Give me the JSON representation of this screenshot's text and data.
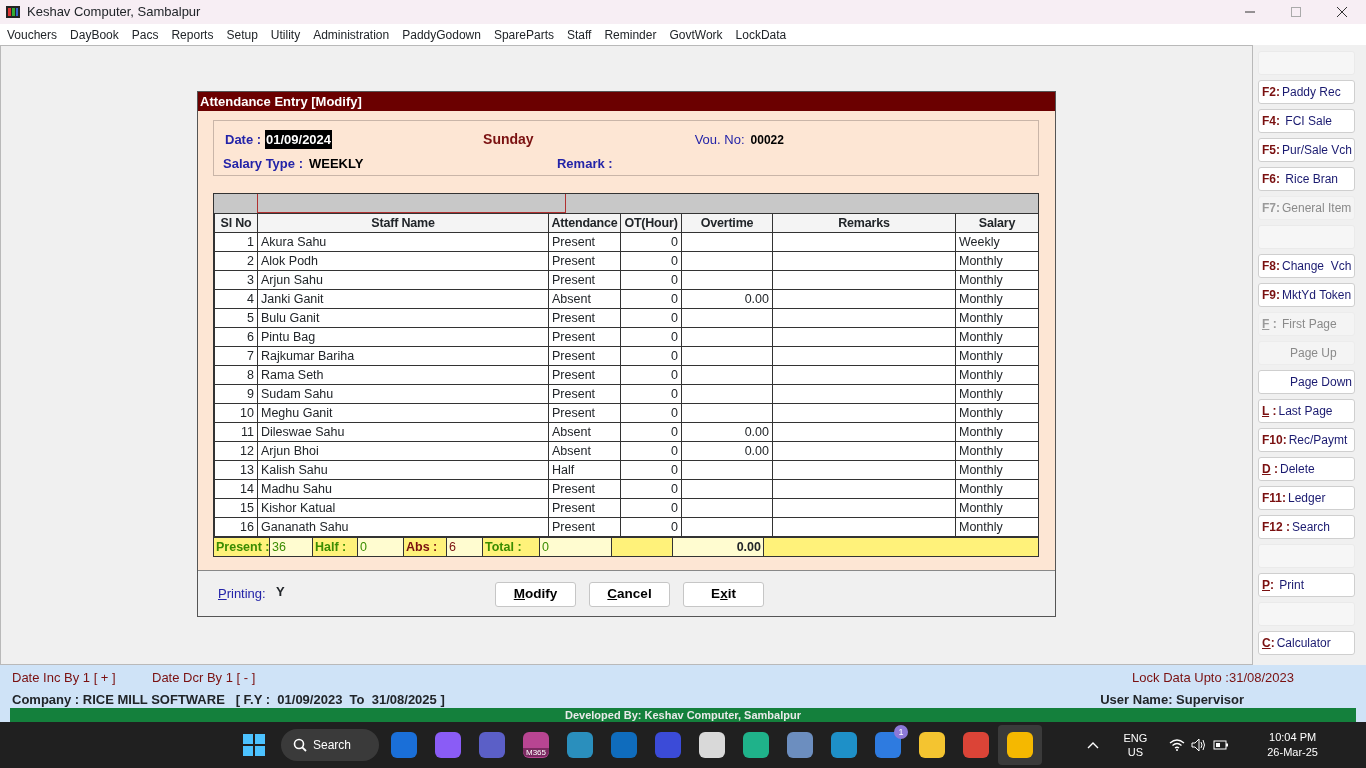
{
  "window": {
    "title": "Keshav Computer, Sambalpur"
  },
  "menu": [
    "Vouchers",
    "DayBook",
    "Pacs",
    "Reports",
    "Setup",
    "Utility",
    "Administration",
    "PaddyGodown",
    "SpareParts",
    "Staff",
    "Reminder",
    "GovtWork",
    "LockData"
  ],
  "dialog": {
    "title": "Attendance Entry [Modify]",
    "date_label": "Date :",
    "date": "01/09/2024",
    "date_selected": true,
    "day": "Sunday",
    "vou_label": "Vou. No:",
    "vou_no": "00022",
    "salary_type_label": "Salary Type :",
    "salary_type": "WEEKLY",
    "remark_label": "Remark :",
    "columns": [
      "Sl No",
      "Staff Name",
      "Attendance",
      "OT(Hour)",
      "Overtime",
      "Remarks",
      "Salary"
    ],
    "rows": [
      {
        "sl": "1",
        "name": "Akura Sahu",
        "attendance": "Present",
        "ot": "0",
        "overtime": "",
        "salary": "Weekly"
      },
      {
        "sl": "2",
        "name": "Alok Podh",
        "attendance": "Present",
        "ot": "0",
        "overtime": "",
        "salary": "Monthly"
      },
      {
        "sl": "3",
        "name": "Arjun Sahu",
        "attendance": "Present",
        "ot": "0",
        "overtime": "",
        "salary": "Monthly"
      },
      {
        "sl": "4",
        "name": "Janki Ganit",
        "attendance": "Absent",
        "ot": "0",
        "overtime": "0.00",
        "salary": "Monthly"
      },
      {
        "sl": "5",
        "name": "Bulu Ganit",
        "attendance": "Present",
        "ot": "0",
        "overtime": "",
        "salary": "Monthly"
      },
      {
        "sl": "6",
        "name": "Pintu Bag",
        "attendance": "Present",
        "ot": "0",
        "overtime": "",
        "salary": "Monthly"
      },
      {
        "sl": "7",
        "name": "Rajkumar Bariha",
        "attendance": "Present",
        "ot": "0",
        "overtime": "",
        "salary": "Monthly"
      },
      {
        "sl": "8",
        "name": "Rama Seth",
        "attendance": "Present",
        "ot": "0",
        "overtime": "",
        "salary": "Monthly"
      },
      {
        "sl": "9",
        "name": "Sudam Sahu",
        "attendance": "Present",
        "ot": "0",
        "overtime": "",
        "salary": "Monthly"
      },
      {
        "sl": "10",
        "name": "Meghu Ganit",
        "attendance": "Present",
        "ot": "0",
        "overtime": "",
        "salary": "Monthly"
      },
      {
        "sl": "11",
        "name": "Dileswae Sahu",
        "attendance": "Absent",
        "ot": "0",
        "overtime": "0.00",
        "salary": "Monthly"
      },
      {
        "sl": "12",
        "name": "Arjun Bhoi",
        "attendance": "Absent",
        "ot": "0",
        "overtime": "0.00",
        "salary": "Monthly"
      },
      {
        "sl": "13",
        "name": "Kalish Sahu",
        "attendance": "Half",
        "ot": "0",
        "overtime": "",
        "salary": "Monthly"
      },
      {
        "sl": "14",
        "name": "Madhu Sahu",
        "attendance": "Present",
        "ot": "0",
        "overtime": "",
        "salary": "Monthly"
      },
      {
        "sl": "15",
        "name": "Kishor Katual",
        "attendance": "Present",
        "ot": "0",
        "overtime": "",
        "salary": "Monthly"
      },
      {
        "sl": "16",
        "name": "Gananath Sahu",
        "attendance": "Present",
        "ot": "0",
        "overtime": "",
        "salary": "Monthly"
      }
    ],
    "summary": [
      {
        "label": "Present :",
        "value": "36"
      },
      {
        "label": "Half :",
        "value": "0"
      },
      {
        "label": "Abs :",
        "value": "6"
      },
      {
        "label": "Total :",
        "value": "0"
      }
    ],
    "overtime_total": "0.00",
    "printing_label": "Printing:",
    "printing": "Y",
    "buttons": [
      {
        "key": "M",
        "post": "odify"
      },
      {
        "key": "C",
        "post": "ancel"
      },
      {
        "pre": "E",
        "key": "x",
        "post": "it"
      }
    ]
  },
  "side_buttons": [
    {
      "kind": "blank"
    },
    {
      "kind": "button",
      "key": "F2:",
      "label": "Paddy Rec",
      "underline": false,
      "disabled": false
    },
    {
      "kind": "button",
      "key": "F4:",
      "label": " FCI Sale",
      "underline": false,
      "disabled": false
    },
    {
      "kind": "button",
      "key": "F5:",
      "label": "Pur/Sale Vch",
      "underline": false,
      "disabled": false
    },
    {
      "kind": "button",
      "key": "F6:",
      "label": " Rice Bran",
      "underline": false,
      "disabled": false
    },
    {
      "kind": "button",
      "key": "F7:",
      "label": "General Item",
      "underline": false,
      "disabled": true
    },
    {
      "kind": "blank"
    },
    {
      "kind": "button",
      "key": "F8:",
      "label": "Change  Vch",
      "underline": false,
      "disabled": false
    },
    {
      "kind": "button",
      "key": "F9:",
      "label": "MktYd Token",
      "underline": false,
      "disabled": false
    },
    {
      "kind": "button",
      "key": "F :",
      "label": " First Page",
      "underline": true,
      "disabled": true
    },
    {
      "kind": "button",
      "label": "Page Up",
      "disabled": true
    },
    {
      "kind": "button",
      "label": "Page Down",
      "disabled": false
    },
    {
      "kind": "button",
      "key": "L :",
      "label": "Last Page",
      "underline": true,
      "disabled": false
    },
    {
      "kind": "button",
      "key": "F10:",
      "label": "Rec/Paymt",
      "underline": false,
      "disabled": false
    },
    {
      "kind": "button",
      "key": "D :",
      "label": "Delete",
      "underline": true,
      "disabled": false
    },
    {
      "kind": "button",
      "key": "F11:",
      "label": "Ledger",
      "underline": false,
      "disabled": false
    },
    {
      "kind": "button",
      "key": "F12 :",
      "label": "Search",
      "underline": false,
      "disabled": false
    },
    {
      "kind": "blank"
    },
    {
      "kind": "button",
      "key": "P:",
      "label": " Print",
      "underline": true,
      "disabled": false
    },
    {
      "kind": "blank"
    },
    {
      "kind": "button",
      "key": "C:",
      "label": "Calculator",
      "underline": true,
      "disabled": false
    }
  ],
  "status": {
    "date_inc": "Date Inc By 1 [ + ]",
    "date_dcr": "Date Dcr By 1 [ - ]",
    "lock": "Lock Data Upto :31/08/2023",
    "company": "Company : RICE MILL SOFTWARE   [ F.Y :  01/09/2023  To  31/08/2025 ]",
    "user": "User Name: Supervisor",
    "developed": "Developed By: Keshav Computer, Sambalpur"
  },
  "taskbar": {
    "search": "Search",
    "apps": [
      {
        "color": "#1a6fd8",
        "selected": false
      },
      {
        "color": "#8a5cf6",
        "selected": false
      },
      {
        "color": "#5b5fc7",
        "selected": false
      },
      {
        "color": "#b84592",
        "label": "M365",
        "selected": false
      },
      {
        "color": "#2a8fbd",
        "selected": false
      },
      {
        "color": "#0f6cbd",
        "selected": false
      },
      {
        "color": "#3b4bd8",
        "selected": false
      },
      {
        "color": "#d9d9d9",
        "selected": false
      },
      {
        "color": "#1fb28a",
        "selected": false
      },
      {
        "color": "#6c8ebf",
        "selected": false
      },
      {
        "color": "#1e90c8",
        "selected": false
      },
      {
        "color": "#2e7be0",
        "badge": "1",
        "selected": false
      },
      {
        "color": "#f4c430",
        "selected": false
      },
      {
        "color": "#db4437",
        "selected": false
      },
      {
        "color": "#f5b800",
        "selected": true
      }
    ],
    "lang": "ENG",
    "region": "US",
    "time": "10:04 PM",
    "date": "26-Mar-25"
  }
}
